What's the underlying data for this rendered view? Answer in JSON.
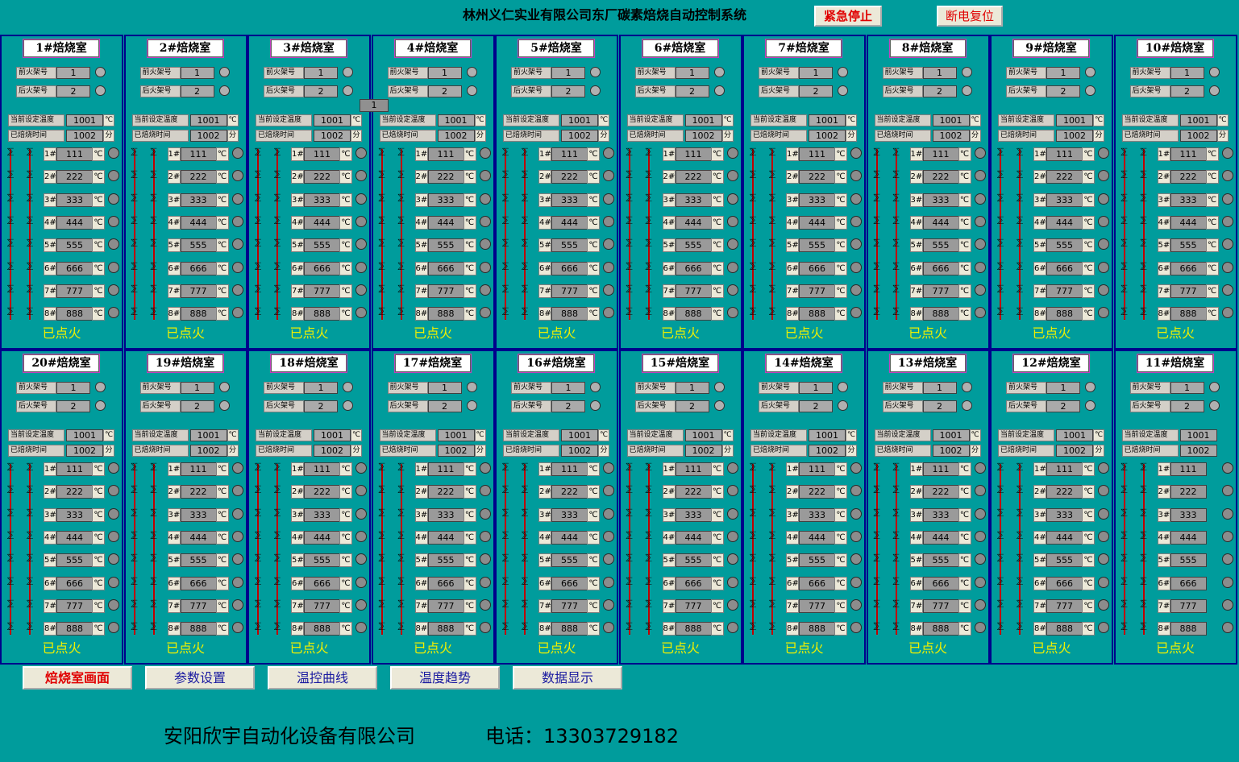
{
  "title": "林州义仁实业有限公司东厂碳素焙烧自动控制系统",
  "buttons": {
    "emergency_stop": "紧急停止",
    "power_reset": "断电复位"
  },
  "panel_common": {
    "front_fire_label": "前火架号",
    "front_fire_value": "1",
    "back_fire_label": "后火架号",
    "back_fire_value": "2",
    "set_temp_label": "当前设定温度",
    "set_temp_value": "1001",
    "set_temp_unit": "℃",
    "fired_time_label": "已焙烧时间",
    "fired_time_value": "1002",
    "fired_time_unit": "分",
    "zones": [
      {
        "label": "1#",
        "value": "111",
        "unit": "℃"
      },
      {
        "label": "2#",
        "value": "222",
        "unit": "℃"
      },
      {
        "label": "3#",
        "value": "333",
        "unit": "℃"
      },
      {
        "label": "4#",
        "value": "444",
        "unit": "℃"
      },
      {
        "label": "5#",
        "value": "555",
        "unit": "℃"
      },
      {
        "label": "6#",
        "value": "666",
        "unit": "℃"
      },
      {
        "label": "7#",
        "value": "777",
        "unit": "℃"
      },
      {
        "label": "8#",
        "value": "888",
        "unit": "℃"
      }
    ],
    "status": "已点火"
  },
  "rooms_top": [
    "1#焙烧室",
    "2#焙烧室",
    "3#焙烧室",
    "4#焙烧室",
    "5#焙烧室",
    "6#焙烧室",
    "7#焙烧室",
    "8#焙烧室",
    "9#焙烧室",
    "10#焙烧室"
  ],
  "rooms_bottom": [
    "20#焙烧室",
    "19#焙烧室",
    "18#焙烧室",
    "17#焙烧室",
    "16#焙烧室",
    "15#焙烧室",
    "14#焙烧室",
    "13#焙烧室",
    "12#焙烧室",
    "11#焙烧室"
  ],
  "floating_indicator": "1",
  "nav": [
    {
      "label": "焙烧室画面",
      "active": true
    },
    {
      "label": "参数设置",
      "active": false
    },
    {
      "label": "温控曲线",
      "active": false
    },
    {
      "label": "温度趋势",
      "active": false
    },
    {
      "label": "数据显示",
      "active": false
    }
  ],
  "footer": {
    "company": "安阳欣宇自动化设备有限公司",
    "phone": "电话：13303729182"
  },
  "colors": {
    "background": "#009c9c",
    "panel_border": "#00008b",
    "status_text": "#f0f000",
    "active_nav_text": "#e00000",
    "nav_text": "#1a1aa0",
    "emergency_text": "#e00000"
  }
}
